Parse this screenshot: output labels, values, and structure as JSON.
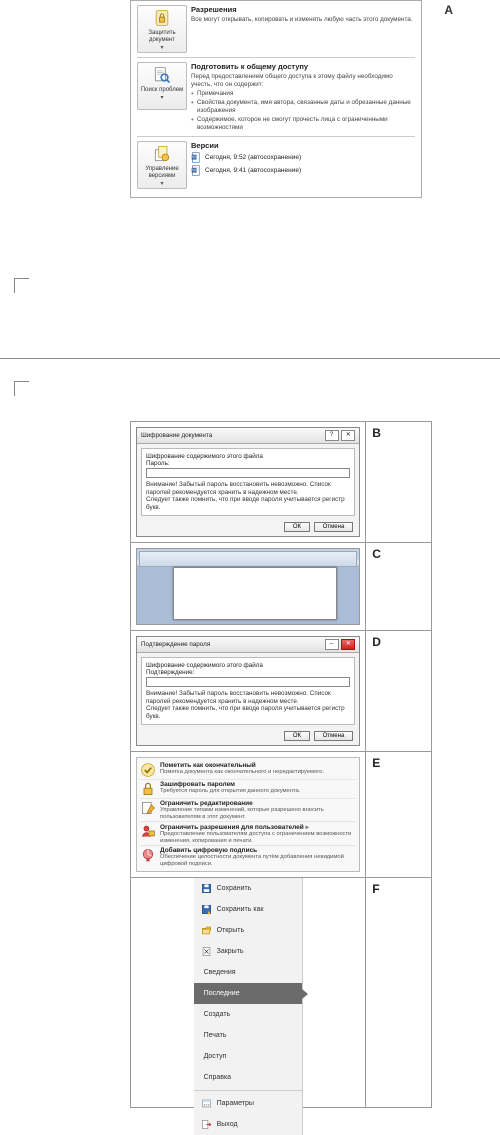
{
  "labels": {
    "A": "A",
    "B": "B",
    "C": "C",
    "D": "D",
    "E": "E",
    "F": "F"
  },
  "panelA": {
    "protect": {
      "btn": "Защитить\nдокумент",
      "title": "Разрешения",
      "desc": "Все могут открывать, копировать и изменять любую часть этого документа."
    },
    "inspect": {
      "btn": "Поиск\nпроблем",
      "title": "Подготовить к общему доступу",
      "intro": "Перед предоставлением общего доступа к этому файлу необходимо учесть, что он содержит:",
      "b1": "Примечания",
      "b2": "Свойства документа, имя автора, связанные даты и обрезанные данные изображения",
      "b3": "Содержимое, которое не смогут прочесть лица с ограниченными возможностями"
    },
    "versions": {
      "btn": "Управление\nверсиями",
      "title": "Версии",
      "v1": "Сегодня, 9:52 (автосохранение)",
      "v2": "Сегодня, 9:41 (автосохранение)"
    }
  },
  "panelB": {
    "title": "Шифрование документа",
    "head": "Шифрование содержимого этого файла",
    "fieldLabel": "Пароль:",
    "note": "Внимание! Забытый пароль восстановить невозможно. Список паролей рекомендуется хранить в надежном месте.\nСледует также помнить, что при вводе пароля учитывается регистр букв.",
    "ok": "ОК",
    "cancel": "Отмена"
  },
  "panelD": {
    "title": "Подтверждение пароля",
    "head": "Шифрование содержимого этого файла",
    "fieldLabel": "Подтверждение:",
    "note": "Внимание! Забытый пароль восстановить невозможно. Список паролей рекомендуется хранить в надежном месте.\nСледует также помнить, что при вводе пароля учитывается регистр букв.",
    "ok": "ОК",
    "cancel": "Отмена"
  },
  "panelE": {
    "items": [
      {
        "t1": "Пометить как окончательный",
        "t2": "Пометка документа как окончательного и нередактируемого."
      },
      {
        "t1": "Зашифровать паролем",
        "t2": "Требуется пароль для открытия данного документа."
      },
      {
        "t1": "Ограничить редактирование",
        "t2": "Управление типами изменений, которые разрешено вносить пользователям в этот документ."
      },
      {
        "t1": "Ограничить разрешения для пользователей",
        "t2": "Предоставление пользователям доступа с ограничением возможности изменения, копирования и печати."
      },
      {
        "t1": "Добавить цифровую подпись",
        "t2": "Обеспечение целостности документа путём добавления невидимой цифровой подписи."
      }
    ]
  },
  "panelF": {
    "items": [
      {
        "label": "Сохранить",
        "icon": true
      },
      {
        "label": "Сохранить как",
        "icon": true
      },
      {
        "label": "Открыть",
        "icon": true
      },
      {
        "label": "Закрыть",
        "icon": true
      },
      {
        "label": "Сведения",
        "simple": true
      },
      {
        "label": "Последние",
        "simple": true,
        "selected": true
      },
      {
        "label": "Создать",
        "simple": true
      },
      {
        "label": "Печать",
        "simple": true
      },
      {
        "label": "Доступ",
        "simple": true
      },
      {
        "label": "Справка",
        "simple": true
      },
      {
        "label": "Параметры",
        "icon": true,
        "sepBefore": true
      },
      {
        "label": "Выход",
        "icon": true
      }
    ]
  }
}
